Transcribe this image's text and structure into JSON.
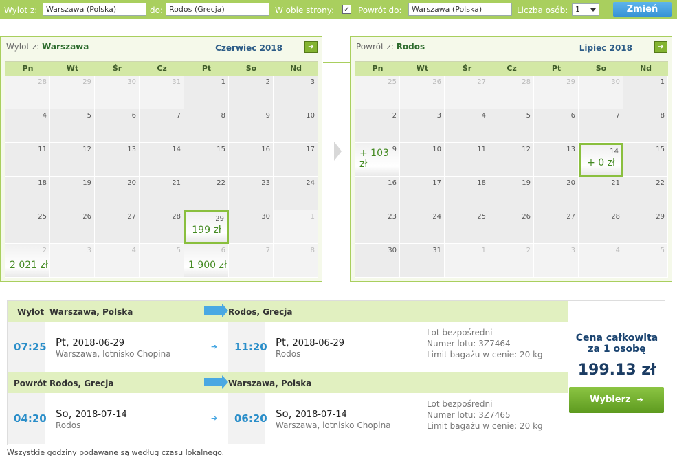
{
  "search": {
    "from_label": "Wylot z:",
    "from_value": "Warszawa (Polska)",
    "to_label": "do:",
    "to_value": "Rodos (Grecja)",
    "roundtrip_label": "W obie strony:",
    "roundtrip_check": "✓",
    "return_label": "Powrót do:",
    "return_value": "Warszawa (Polska)",
    "persons_label": "Liczba osób:",
    "persons_value": "1",
    "change_button": "Zmień"
  },
  "calendars": [
    {
      "title_prefix": "Wylot z:",
      "title_city": "Warszawa",
      "month": "Czerwiec 2018",
      "weekdays": [
        "Pn",
        "Wt",
        "Śr",
        "Cz",
        "Pt",
        "So",
        "Nd"
      ],
      "weeks": [
        [
          {
            "d": "28",
            "o": true
          },
          {
            "d": "29",
            "o": true
          },
          {
            "d": "30",
            "o": true
          },
          {
            "d": "31",
            "o": true
          },
          {
            "d": "1"
          },
          {
            "d": "2"
          },
          {
            "d": "3"
          }
        ],
        [
          {
            "d": "4"
          },
          {
            "d": "5"
          },
          {
            "d": "6"
          },
          {
            "d": "7"
          },
          {
            "d": "8"
          },
          {
            "d": "9"
          },
          {
            "d": "10"
          }
        ],
        [
          {
            "d": "11"
          },
          {
            "d": "12"
          },
          {
            "d": "13"
          },
          {
            "d": "14"
          },
          {
            "d": "15"
          },
          {
            "d": "16"
          },
          {
            "d": "17"
          }
        ],
        [
          {
            "d": "18"
          },
          {
            "d": "19"
          },
          {
            "d": "20"
          },
          {
            "d": "21"
          },
          {
            "d": "22"
          },
          {
            "d": "23"
          },
          {
            "d": "24"
          }
        ],
        [
          {
            "d": "25"
          },
          {
            "d": "26"
          },
          {
            "d": "27"
          },
          {
            "d": "28"
          },
          {
            "d": "29",
            "p": "199 zł",
            "sel": true
          },
          {
            "d": "30"
          },
          {
            "d": "1",
            "o": true
          }
        ],
        [
          {
            "d": "2",
            "o": true,
            "p": "2 021 zł"
          },
          {
            "d": "3",
            "o": true
          },
          {
            "d": "4",
            "o": true
          },
          {
            "d": "5",
            "o": true
          },
          {
            "d": "6",
            "o": true,
            "p": "1 900 zł"
          },
          {
            "d": "7",
            "o": true
          },
          {
            "d": "8",
            "o": true
          }
        ]
      ]
    },
    {
      "title_prefix": "Powrót z:",
      "title_city": "Rodos",
      "month": "Lipiec 2018",
      "weekdays": [
        "Pn",
        "Wt",
        "Śr",
        "Cz",
        "Pt",
        "So",
        "Nd"
      ],
      "weeks": [
        [
          {
            "d": "25",
            "o": true
          },
          {
            "d": "26",
            "o": true
          },
          {
            "d": "27",
            "o": true
          },
          {
            "d": "28",
            "o": true
          },
          {
            "d": "29",
            "o": true
          },
          {
            "d": "30",
            "o": true
          },
          {
            "d": "1"
          }
        ],
        [
          {
            "d": "2"
          },
          {
            "d": "3"
          },
          {
            "d": "4"
          },
          {
            "d": "5"
          },
          {
            "d": "6"
          },
          {
            "d": "7"
          },
          {
            "d": "8"
          }
        ],
        [
          {
            "d": "9",
            "p": "+ 103 zł"
          },
          {
            "d": "10"
          },
          {
            "d": "11"
          },
          {
            "d": "12"
          },
          {
            "d": "13"
          },
          {
            "d": "14",
            "p": "+ 0 zł",
            "sel": true
          },
          {
            "d": "15"
          }
        ],
        [
          {
            "d": "16"
          },
          {
            "d": "17"
          },
          {
            "d": "18"
          },
          {
            "d": "19"
          },
          {
            "d": "20"
          },
          {
            "d": "21"
          },
          {
            "d": "22"
          }
        ],
        [
          {
            "d": "23"
          },
          {
            "d": "24"
          },
          {
            "d": "25"
          },
          {
            "d": "26"
          },
          {
            "d": "27"
          },
          {
            "d": "28"
          },
          {
            "d": "29"
          }
        ],
        [
          {
            "d": "30"
          },
          {
            "d": "31"
          },
          {
            "d": "1",
            "o": true
          },
          {
            "d": "2",
            "o": true
          },
          {
            "d": "3",
            "o": true
          },
          {
            "d": "4",
            "o": true
          },
          {
            "d": "5",
            "o": true
          }
        ]
      ]
    }
  ],
  "legs": [
    {
      "header_label": "Wylot",
      "header_from": "Warszawa, Polska",
      "header_to": "Rodos, Grecja",
      "dep_time": "07:25",
      "dep_day": "Pt,",
      "dep_date": "2018-06-29",
      "dep_place": "Warszawa, lotnisko Chopina",
      "arr_time": "11:20",
      "arr_day": "Pt,",
      "arr_date": "2018-06-29",
      "arr_place": "Rodos",
      "info1": "Lot bezpośredni",
      "info2": "Numer lotu: 3Z7464",
      "info3": "Limit bagażu w cenie: 20 kg"
    },
    {
      "header_label": "Powrót",
      "header_from": "Rodos, Grecja",
      "header_to": "Warszawa, Polska",
      "dep_time": "04:20",
      "dep_day": "So,",
      "dep_date": "2018-07-14",
      "dep_place": "Rodos",
      "arr_time": "06:20",
      "arr_day": "So,",
      "arr_date": "2018-07-14",
      "arr_place": "Warszawa, lotnisko Chopina",
      "info1": "Lot bezpośredni",
      "info2": "Numer lotu: 3Z7465",
      "info3": "Limit bagażu w cenie: 20 kg"
    }
  ],
  "price": {
    "label_line1": "Cena całkowita",
    "label_line2": "za 1 osobę",
    "amount": "199.13 zł",
    "select_button": "Wybierz",
    "select_arrow": "➔"
  },
  "footnote": "Wszystkie godziny podawane są według czasu lokalnego.",
  "icons": {
    "next_arrow": "➔",
    "small_arrow": "➔"
  },
  "colors": {
    "accent_green": "#a9cf5e",
    "blue": "#2a8ec9",
    "price_green": "#448a22"
  }
}
